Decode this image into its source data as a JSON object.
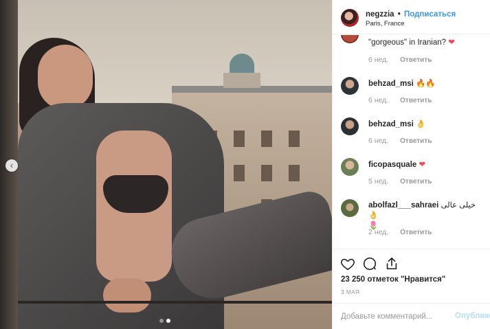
{
  "post": {
    "author": "negzzia",
    "separator": "•",
    "follow_label": "Подписаться",
    "location": "Paris, France",
    "likes_text": "23 250 отметок \"Нравится\"",
    "date_text": "3 МАЯ",
    "comment_placeholder": "Добавьте комментарий...",
    "publish_label": "Опубликовать"
  },
  "carousel": {
    "prev_symbol": "‹",
    "current_index": 1,
    "total": 2
  },
  "comments": [
    {
      "username": "",
      "text": "\"gorgeous\" in Iranian?",
      "emoji": "❤",
      "emoji_class": "heart",
      "time": "6 нед.",
      "reply": "Ответить"
    },
    {
      "username": "behzad_msi",
      "text": "",
      "emoji": "🔥🔥",
      "emoji_class": "fire",
      "time": "6 нед.",
      "reply": "Ответить"
    },
    {
      "username": "behzad_msi",
      "text": "",
      "emoji": "👌",
      "emoji_class": "okhand",
      "time": "6 нед.",
      "reply": "Ответить"
    },
    {
      "username": "ficopasquale",
      "text": "",
      "emoji": "❤",
      "emoji_class": "heart",
      "time": "5 нед.",
      "reply": "Ответить"
    },
    {
      "username": "abolfazl___sahraei",
      "text": "خیلی عالی",
      "emoji": "👌",
      "emoji_class": "okhand",
      "emoji2": "🌷",
      "time": "2 нед.",
      "reply": "Ответить"
    }
  ],
  "icons": {
    "like": "heart-outline-icon",
    "comment": "comment-bubble-icon",
    "share": "share-arrow-icon"
  },
  "colors": {
    "accent_blue": "#3897f0",
    "publish_disabled": "#b2dffc",
    "heart_red": "#ed4956",
    "muted_text": "#999999",
    "border": "#efefef"
  }
}
